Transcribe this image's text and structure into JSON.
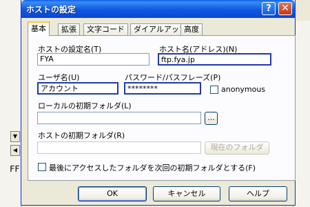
{
  "window": {
    "title": "ホストの設定",
    "help_glyph": "?",
    "close_glyph": "✕"
  },
  "background": {
    "left_text": "FF",
    "scroll_down_glyph": "▼",
    "scroll_left_glyph": "◀"
  },
  "tabs": [
    {
      "label": "基本",
      "active": true
    },
    {
      "label": "拡張",
      "active": false
    },
    {
      "label": "文字コード",
      "active": false
    },
    {
      "label": "ダイアルアップ",
      "active": false
    },
    {
      "label": "高度",
      "active": false
    }
  ],
  "form": {
    "host_setting_name": {
      "label": "ホストの設定名(T)",
      "value": "FYA"
    },
    "host_name": {
      "label": "ホスト名(アドレス)(N)",
      "value": "ftp.fya.jp"
    },
    "user_name": {
      "label": "ユーザ名(U)",
      "value": "アカウント"
    },
    "password": {
      "label": "パスワード/パスフレーズ(P)",
      "value": "********"
    },
    "anonymous": {
      "label": "anonymous",
      "checked": false
    },
    "local_folder": {
      "label": "ローカルの初期フォルダ(L)",
      "value": "",
      "browse_label": "..."
    },
    "host_folder": {
      "label": "ホストの初期フォルダ(R)",
      "value": "",
      "current_button": "現在のフォルダ"
    },
    "last_access": {
      "label": "最後にアクセスしたフォルダを次回の初期フォルダとする(F)",
      "checked": false
    }
  },
  "buttons": {
    "ok": "OK",
    "cancel": "キャンセル",
    "help": "ヘルプ"
  }
}
